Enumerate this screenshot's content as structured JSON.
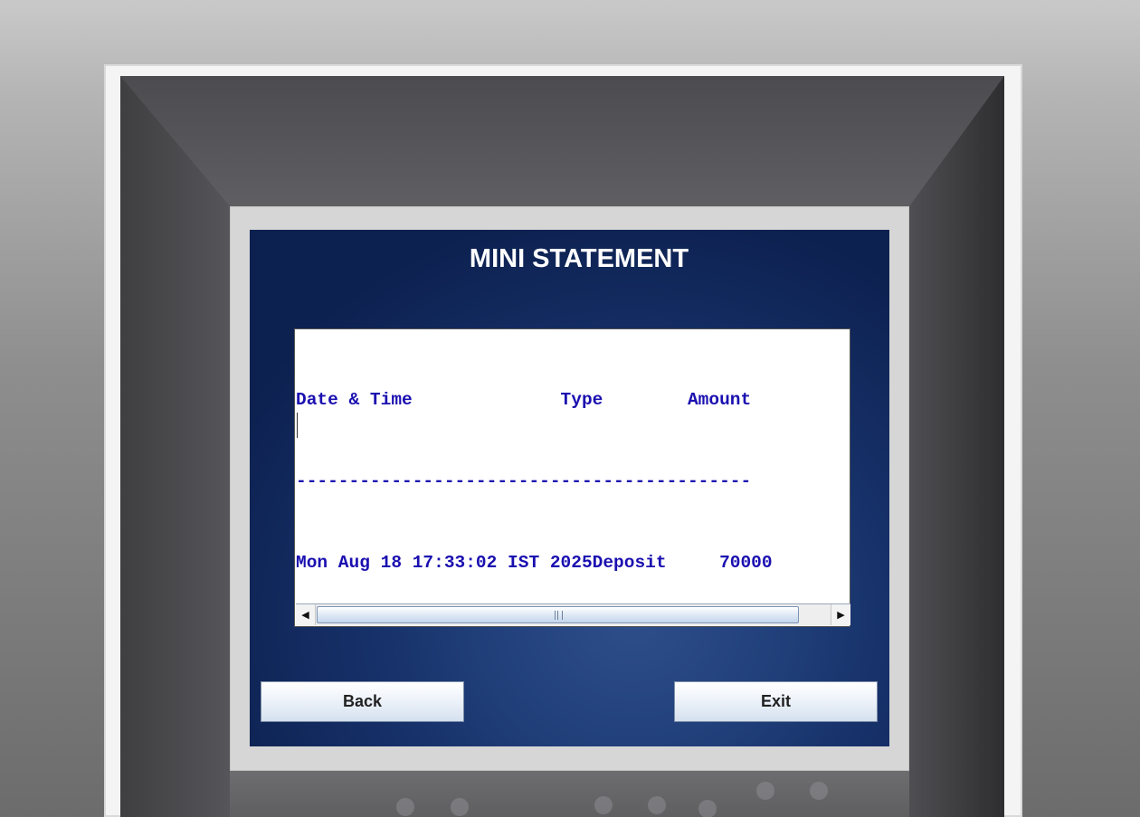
{
  "screen": {
    "title": "MINI STATEMENT"
  },
  "statement": {
    "lines": [
      "Date & Time              Type        Amount",
      "-------------------------------------------",
      "Mon Aug 18 17:33:02 IST 2025Deposit     70000"
    ]
  },
  "scrollbar": {
    "left_arrow": "◀",
    "right_arrow": "▶"
  },
  "buttons": {
    "back_label": "Back",
    "exit_label": "Exit"
  }
}
